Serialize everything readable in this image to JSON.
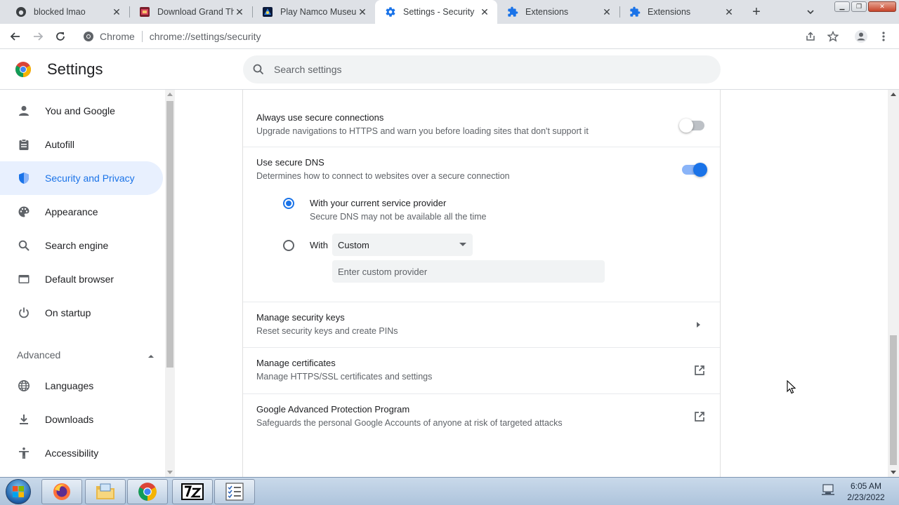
{
  "browser": {
    "tabs": [
      {
        "title": "blocked lmao",
        "favicon": "github-icon",
        "active": false
      },
      {
        "title": "Download Grand The",
        "favicon": "game-icon",
        "active": false
      },
      {
        "title": "Play Namco Museum",
        "favicon": "game-icon",
        "active": false
      },
      {
        "title": "Settings - Security",
        "favicon": "gear-icon",
        "active": true
      },
      {
        "title": "Extensions",
        "favicon": "puzzle-icon",
        "active": false
      },
      {
        "title": "Extensions",
        "favicon": "puzzle-icon",
        "active": false
      }
    ],
    "omnibox": {
      "scheme_label": "Chrome",
      "url": "chrome://settings/security"
    }
  },
  "settings": {
    "title": "Settings",
    "search_placeholder": "Search settings",
    "sidebar": {
      "items": [
        {
          "label": "You and Google",
          "icon": "person-icon"
        },
        {
          "label": "Autofill",
          "icon": "clipboard-icon"
        },
        {
          "label": "Security and Privacy",
          "icon": "shield-icon",
          "active": true
        },
        {
          "label": "Appearance",
          "icon": "palette-icon"
        },
        {
          "label": "Search engine",
          "icon": "search-icon"
        },
        {
          "label": "Default browser",
          "icon": "browser-icon"
        },
        {
          "label": "On startup",
          "icon": "power-icon"
        }
      ],
      "advanced_label": "Advanced",
      "advanced_items": [
        {
          "label": "Languages",
          "icon": "globe-icon"
        },
        {
          "label": "Downloads",
          "icon": "download-icon"
        },
        {
          "label": "Accessibility",
          "icon": "accessibility-icon"
        }
      ]
    },
    "rows": {
      "secure_connections": {
        "title": "Always use secure connections",
        "subtitle": "Upgrade navigations to HTTPS and warn you before loading sites that don't support it",
        "enabled": false
      },
      "secure_dns": {
        "title": "Use secure DNS",
        "subtitle": "Determines how to connect to websites over a secure connection",
        "enabled": true,
        "option_current_title": "With your current service provider",
        "option_current_subtitle": "Secure DNS may not be available all the time",
        "option_custom_label": "With",
        "custom_select_value": "Custom",
        "custom_input_placeholder": "Enter custom provider",
        "selected_option": "current"
      },
      "security_keys": {
        "title": "Manage security keys",
        "subtitle": "Reset security keys and create PINs"
      },
      "certificates": {
        "title": "Manage certificates",
        "subtitle": "Manage HTTPS/SSL certificates and settings"
      },
      "advanced_protection": {
        "title": "Google Advanced Protection Program",
        "subtitle": "Safeguards the personal Google Accounts of anyone at risk of targeted attacks"
      }
    }
  },
  "taskbar": {
    "apps": [
      "firefox-icon",
      "file-explorer-icon",
      "chrome-icon",
      "7zip-icon",
      "task-list-icon"
    ],
    "time": "6:05 AM",
    "date": "2/23/2022"
  },
  "colors": {
    "accent": "#1a73e8",
    "active_bg": "#e8f0fe"
  }
}
